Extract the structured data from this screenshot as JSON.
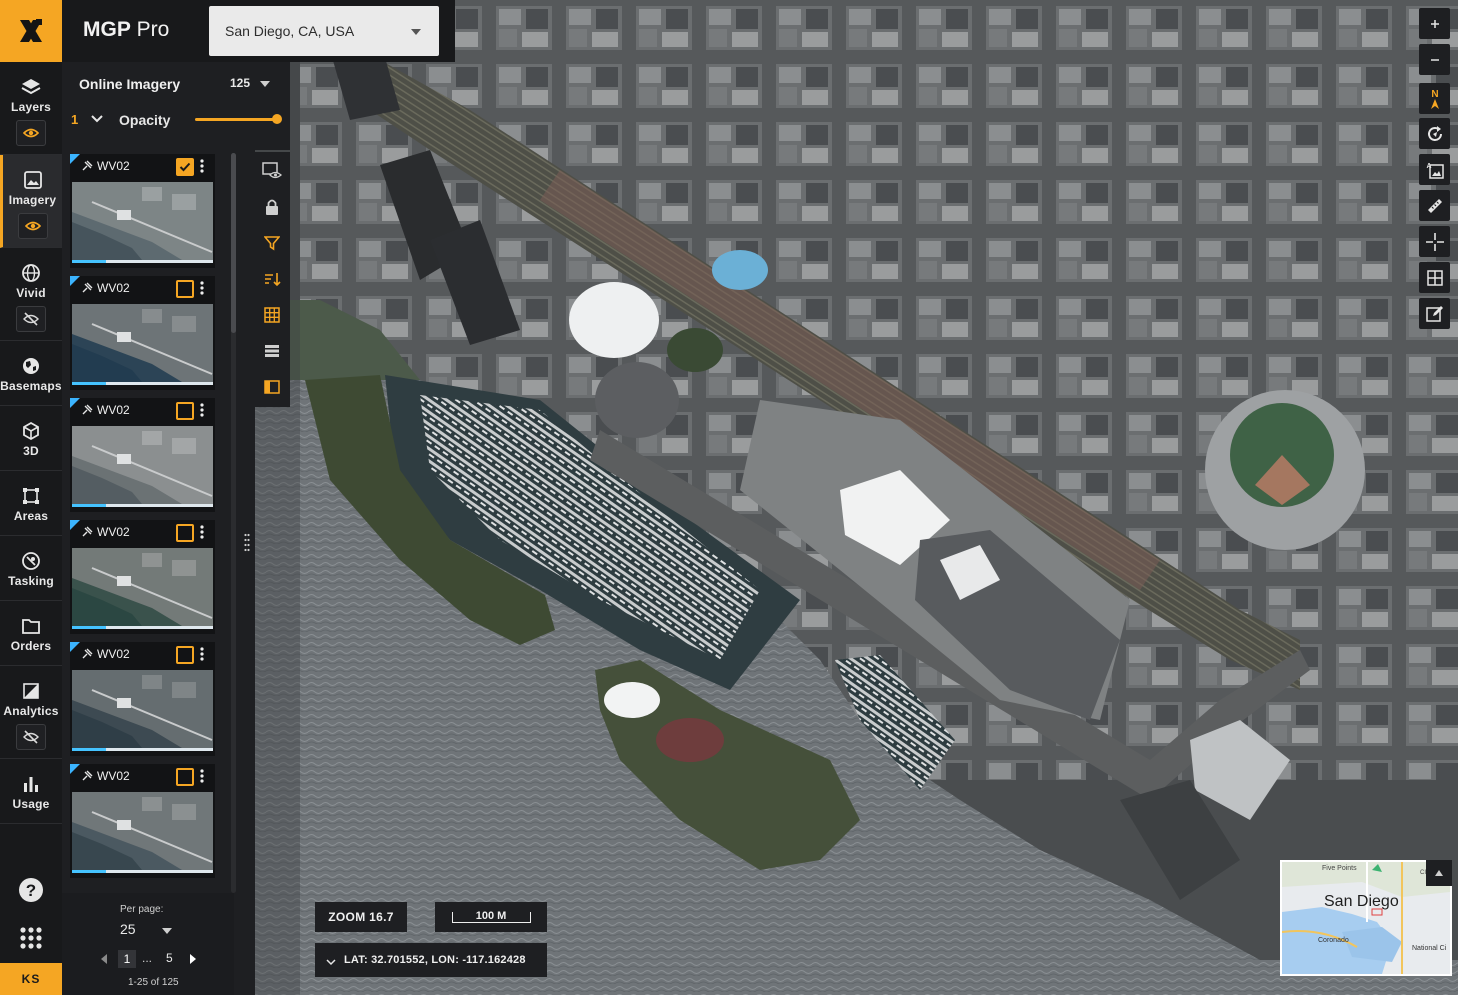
{
  "app": {
    "brand_main": "MGP",
    "brand_sub": " Pro",
    "user_initials": "KS"
  },
  "location": {
    "value": "San Diego, CA, USA"
  },
  "rail": {
    "items": [
      {
        "label": "Layers",
        "has_vis": true,
        "vis": "eye-icon"
      },
      {
        "label": "Imagery",
        "has_vis": true,
        "vis": "eye-icon"
      },
      {
        "label": "Vivid",
        "has_vis": true,
        "vis": "eye-off-icon"
      },
      {
        "label": "Basemaps"
      },
      {
        "label": "3D"
      },
      {
        "label": "Areas"
      },
      {
        "label": "Tasking"
      },
      {
        "label": "Orders"
      },
      {
        "label": "Analytics",
        "has_vis": true,
        "vis": "eye-off-icon"
      },
      {
        "label": "Usage"
      }
    ],
    "active": "Imagery"
  },
  "panel": {
    "title": "Online Imagery",
    "count": "125",
    "opacity_index": "1",
    "opacity_label": "Opacity",
    "opacity_level": 1.0,
    "cards": [
      {
        "name": "WV02",
        "checked": true
      },
      {
        "name": "WV02",
        "checked": false
      },
      {
        "name": "WV02",
        "checked": false
      },
      {
        "name": "WV02",
        "checked": false
      },
      {
        "name": "WV02",
        "checked": false
      },
      {
        "name": "WV02",
        "checked": false
      }
    ],
    "per_page_label": "Per page:",
    "per_page_value": "25",
    "page_current": "1",
    "page_dots": "...",
    "page_last": "5",
    "page_range": "1-25 of 125"
  },
  "map": {
    "zoom": "ZOOM 16.7",
    "scale": "100 M",
    "coords": "LAT: 32.701552, LON: -117.162428",
    "minimap": {
      "city": "San Diego",
      "labels": [
        "Five Points",
        "CITY",
        "Coronado",
        "National Ci"
      ]
    }
  },
  "colors": {
    "accent": "#f5a623",
    "panel_bg": "#1e1f22",
    "rail_bg": "#18191b",
    "highlight_blue": "#3bb4ff"
  }
}
